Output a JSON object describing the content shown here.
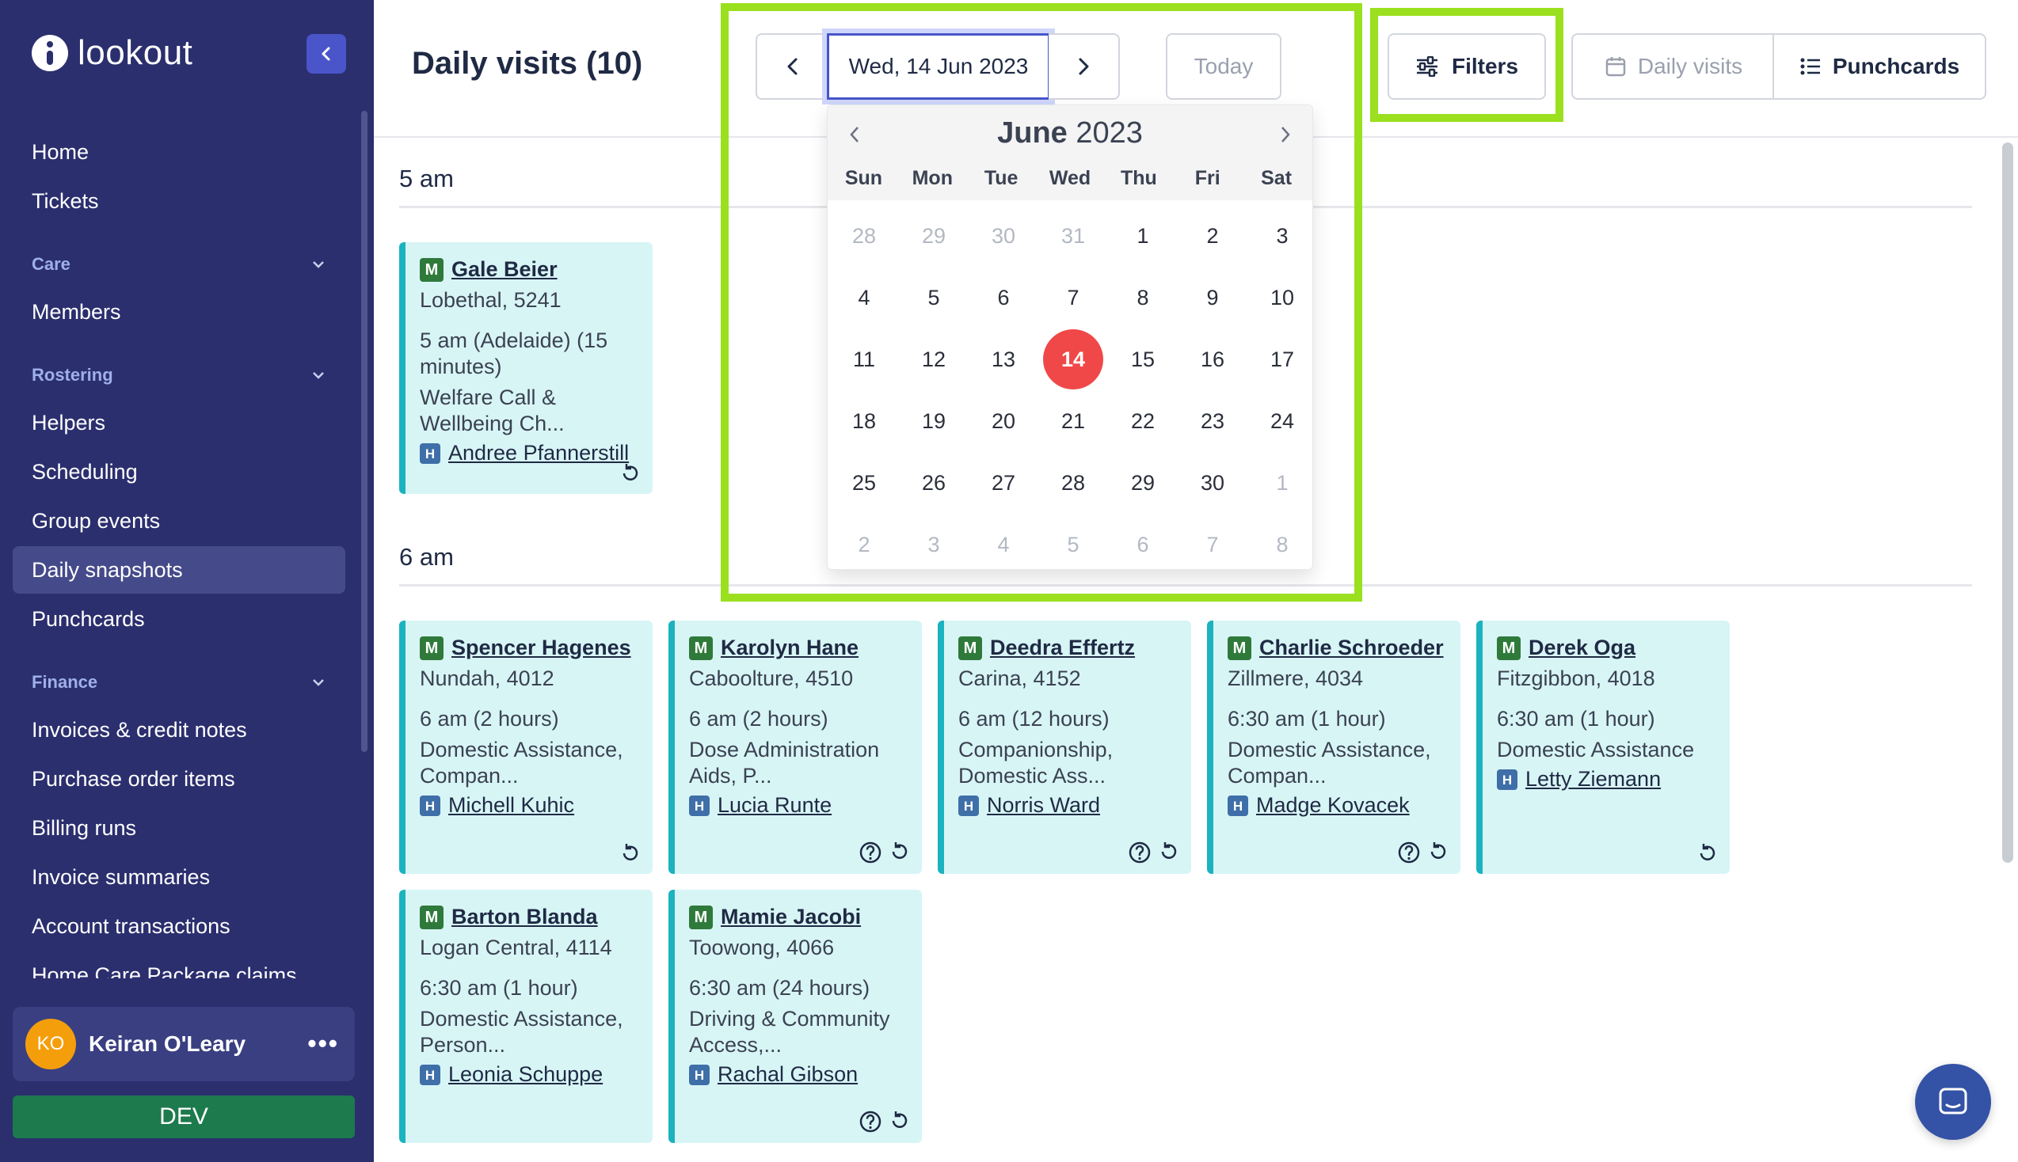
{
  "app": {
    "name": "lookout"
  },
  "sidebar": {
    "items_top": [
      {
        "label": "Home"
      },
      {
        "label": "Tickets"
      }
    ],
    "sections": [
      {
        "title": "Care",
        "items": [
          {
            "label": "Members"
          }
        ]
      },
      {
        "title": "Rostering",
        "items": [
          {
            "label": "Helpers"
          },
          {
            "label": "Scheduling"
          },
          {
            "label": "Group events"
          },
          {
            "label": "Daily snapshots",
            "active": true
          },
          {
            "label": "Punchcards"
          }
        ]
      },
      {
        "title": "Finance",
        "items": [
          {
            "label": "Invoices & credit notes"
          },
          {
            "label": "Purchase order items"
          },
          {
            "label": "Billing runs"
          },
          {
            "label": "Invoice summaries"
          },
          {
            "label": "Account transactions"
          },
          {
            "label": "Home Care Package claims"
          }
        ]
      }
    ],
    "user": {
      "initials": "KO",
      "name": "Keiran O'Leary",
      "menu": "•••"
    },
    "env_badge": "DEV"
  },
  "header": {
    "title": "Daily visits (10)",
    "date_label": "Wed, 14 Jun 2023",
    "today_label": "Today",
    "filters_label": "Filters",
    "daily_visits_label": "Daily visits",
    "punchcards_label": "Punchcards"
  },
  "calendar": {
    "month": "June",
    "year": "2023",
    "weekdays": [
      "Sun",
      "Mon",
      "Tue",
      "Wed",
      "Thu",
      "Fri",
      "Sat"
    ],
    "weeks": [
      [
        "28",
        "29",
        "30",
        "31",
        "1",
        "2",
        "3"
      ],
      [
        "4",
        "5",
        "6",
        "7",
        "8",
        "9",
        "10"
      ],
      [
        "11",
        "12",
        "13",
        "14",
        "15",
        "16",
        "17"
      ],
      [
        "18",
        "19",
        "20",
        "21",
        "22",
        "23",
        "24"
      ],
      [
        "25",
        "26",
        "27",
        "28",
        "29",
        "30",
        "1"
      ],
      [
        "2",
        "3",
        "4",
        "5",
        "6",
        "7",
        "8"
      ]
    ],
    "selected": "14"
  },
  "groups": [
    {
      "time": "5 am"
    },
    {
      "time": "6 am"
    }
  ],
  "visits": [
    {
      "member": "Gale Beier",
      "suburb": "Lobethal, 5241",
      "when": "5 am (Adelaide) (15 minutes)",
      "service": "Welfare Call & Wellbeing Ch...",
      "helper": "Andree Pfannerstill",
      "icons": [
        "repeat-icon"
      ]
    },
    {
      "member": "Spencer Hagenes",
      "suburb": "Nundah, 4012",
      "when": "6 am (2 hours)",
      "service": "Domestic Assistance, Compan...",
      "helper": "Michell Kuhic",
      "icons": [
        "repeat-icon"
      ]
    },
    {
      "member": "Karolyn Hane",
      "suburb": "Caboolture, 4510",
      "when": "6 am (2 hours)",
      "service": "Dose Administration Aids, P...",
      "helper": "Lucia Runte",
      "icons": [
        "question-icon",
        "repeat-icon"
      ]
    },
    {
      "member": "Deedra Effertz",
      "suburb": "Carina, 4152",
      "when": "6 am (12 hours)",
      "service": "Companionship, Domestic Ass...",
      "helper": "Norris Ward",
      "icons": [
        "question-icon",
        "repeat-icon"
      ]
    },
    {
      "member": "Charlie Schroeder",
      "suburb": "Zillmere, 4034",
      "when": "6:30 am (1 hour)",
      "service": "Domestic Assistance, Compan...",
      "helper": "Madge Kovacek",
      "icons": [
        "question-icon",
        "repeat-icon"
      ]
    },
    {
      "member": "Derek Oga",
      "suburb": "Fitzgibbon, 4018",
      "when": "6:30 am (1 hour)",
      "service": "Domestic Assistance",
      "helper": "Letty Ziemann",
      "icons": [
        "repeat-icon"
      ]
    },
    {
      "member": "Barton Blanda",
      "suburb": "Logan Central, 4114",
      "when": "6:30 am (1 hour)",
      "service": "Domestic Assistance, Person...",
      "helper": "Leonia Schuppe",
      "icons": []
    },
    {
      "member": "Mamie Jacobi",
      "suburb": "Toowong, 4066",
      "when": "6:30 am (24 hours)",
      "service": "Driving & Community Access,...",
      "helper": "Rachal Gibson",
      "icons": [
        "question-icon",
        "repeat-icon"
      ]
    }
  ],
  "badges": {
    "member": "M",
    "helper": "H"
  }
}
